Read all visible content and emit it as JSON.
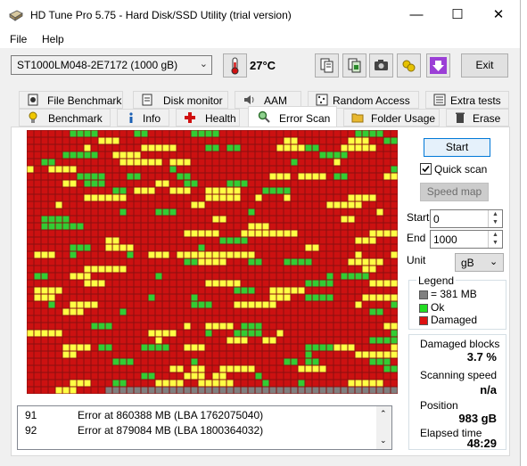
{
  "window": {
    "title": "HD Tune Pro 5.75 - Hard Disk/SSD Utility (trial version)"
  },
  "menu": {
    "file": "File",
    "help": "Help"
  },
  "toolbar": {
    "drive": "ST1000LM048-2E7172 (1000 gB)",
    "temperature": "27°C",
    "exit_label": "Exit"
  },
  "tabs_top": [
    {
      "label": "File Benchmark",
      "icon": "file-benchmark-icon"
    },
    {
      "label": "Disk monitor",
      "icon": "disk-monitor-icon"
    },
    {
      "label": "AAM",
      "icon": "speaker-icon"
    },
    {
      "label": "Random Access",
      "icon": "random-access-icon"
    },
    {
      "label": "Extra tests",
      "icon": "extra-tests-icon"
    }
  ],
  "tabs_bottom": [
    {
      "label": "Benchmark",
      "icon": "lightbulb-icon"
    },
    {
      "label": "Info",
      "icon": "info-icon"
    },
    {
      "label": "Health",
      "icon": "health-cross-icon"
    },
    {
      "label": "Error Scan",
      "icon": "magnifier-icon",
      "active": true
    },
    {
      "label": "Folder Usage",
      "icon": "folder-icon"
    },
    {
      "label": "Erase",
      "icon": "trash-icon"
    }
  ],
  "scan": {
    "start_button": "Start",
    "quick_scan_label": "Quick scan",
    "quick_scan_checked": true,
    "speed_map_button": "Speed map",
    "start_label": "Start",
    "start_value": "0",
    "end_label": "End",
    "end_value": "1000",
    "unit_label": "Unit",
    "unit_value": "gB"
  },
  "legend": {
    "title": "Legend",
    "block_size": "= 381 MB",
    "ok": "Ok",
    "damaged": "Damaged",
    "colors": {
      "damaged": "#cc1111",
      "ok": "#33cc33",
      "reading": "#ffff44",
      "unscanned": "#808080"
    }
  },
  "stats": {
    "damaged_blocks_label": "Damaged blocks",
    "damaged_blocks_value": "3.7 %",
    "scanning_speed_label": "Scanning speed",
    "scanning_speed_value": "n/a",
    "position_label": "Position",
    "position_value": "983 gB",
    "elapsed_label": "Elapsed time",
    "elapsed_value": "48:29"
  },
  "log": [
    {
      "n": "91",
      "text": "Error at 860388 MB (LBA 1762075040)"
    },
    {
      "n": "92",
      "text": "Error at 879084 MB (LBA 1800364032)"
    }
  ]
}
